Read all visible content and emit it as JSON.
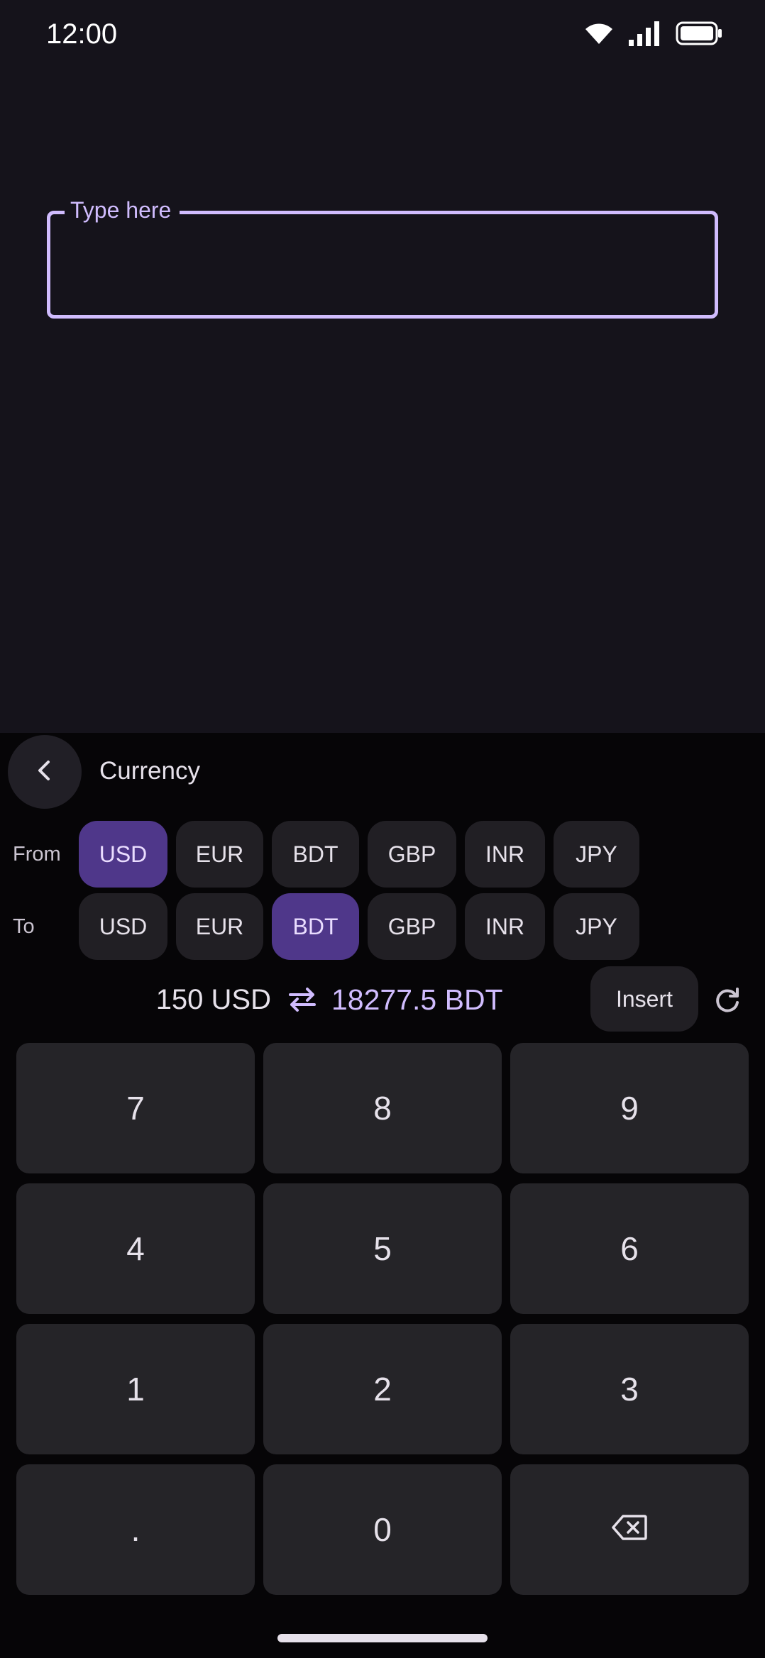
{
  "status_bar": {
    "time": "12:00",
    "icons": [
      "wifi-icon",
      "cellular-signal-icon",
      "battery-icon"
    ]
  },
  "text_field": {
    "label": "Type here",
    "value": ""
  },
  "keyboard": {
    "title": "Currency",
    "back_icon": "chevron-left-icon",
    "from": {
      "label": "From",
      "options": [
        "USD",
        "EUR",
        "BDT",
        "GBP",
        "INR",
        "JPY"
      ],
      "selected": "USD"
    },
    "to": {
      "label": "To",
      "options": [
        "USD",
        "EUR",
        "BDT",
        "GBP",
        "INR",
        "JPY"
      ],
      "selected": "BDT"
    },
    "conversion": {
      "amount": "150 USD",
      "result": "18277.5 BDT",
      "swap_icon": "swap-horiz-icon"
    },
    "insert_label": "Insert",
    "refresh_icon": "refresh-icon",
    "keys": [
      "7",
      "8",
      "9",
      "4",
      "5",
      "6",
      "1",
      "2",
      "3",
      ".",
      "0"
    ],
    "backspace_icon": "backspace-icon"
  },
  "colors": {
    "background": "#15131b",
    "panel": "#060507",
    "surface": "#252428",
    "chip": "#211f24",
    "accent": "#d0bcfe",
    "selected_chip": "#4f378a"
  }
}
